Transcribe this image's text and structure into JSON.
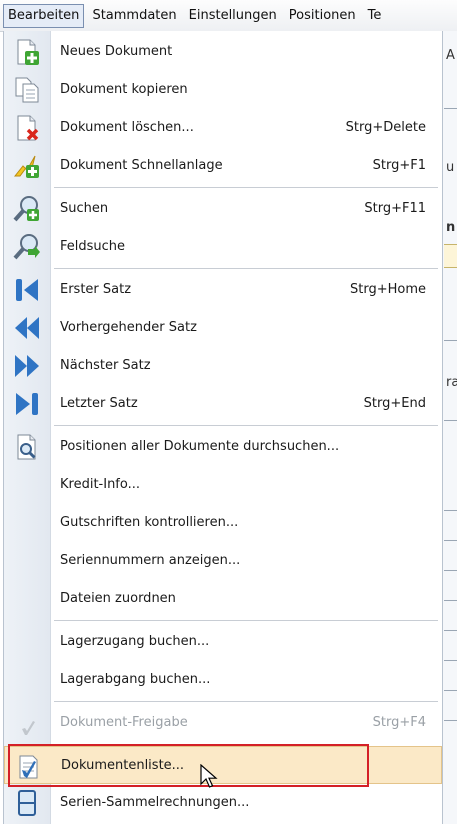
{
  "menubar": {
    "items": [
      {
        "label": "Bearbeiten"
      },
      {
        "label": "Stammdaten"
      },
      {
        "label": "Einstellungen"
      },
      {
        "label": "Positionen"
      },
      {
        "label": "Te"
      }
    ]
  },
  "menu": {
    "items": [
      {
        "label": "Neues Dokument",
        "shortcut": "",
        "icon": "new-document-icon"
      },
      {
        "label": "Dokument kopieren",
        "shortcut": "",
        "icon": "copy-document-icon"
      },
      {
        "label": "Dokument löschen...",
        "shortcut": "Strg+Delete",
        "icon": "delete-document-icon"
      },
      {
        "label": "Dokument Schnellanlage",
        "shortcut": "Strg+F1",
        "icon": "quick-create-icon"
      },
      {
        "label": "Suchen",
        "shortcut": "Strg+F11",
        "icon": "search-icon"
      },
      {
        "label": "Feldsuche",
        "shortcut": "",
        "icon": "field-search-icon"
      },
      {
        "label": "Erster Satz",
        "shortcut": "Strg+Home",
        "icon": "first-record-icon"
      },
      {
        "label": "Vorhergehender Satz",
        "shortcut": "",
        "icon": "previous-record-icon"
      },
      {
        "label": "Nächster Satz",
        "shortcut": "",
        "icon": "next-record-icon"
      },
      {
        "label": "Letzter Satz",
        "shortcut": "Strg+End",
        "icon": "last-record-icon"
      },
      {
        "label": "Positionen aller Dokumente durchsuchen...",
        "shortcut": "",
        "icon": "search-positions-icon"
      },
      {
        "label": "Kredit-Info...",
        "shortcut": "",
        "icon": ""
      },
      {
        "label": "Gutschriften kontrollieren...",
        "shortcut": "",
        "icon": ""
      },
      {
        "label": "Seriennummern anzeigen...",
        "shortcut": "",
        "icon": ""
      },
      {
        "label": "Dateien zuordnen",
        "shortcut": "",
        "icon": ""
      },
      {
        "label": "Lagerzugang buchen...",
        "shortcut": "",
        "icon": ""
      },
      {
        "label": "Lagerabgang buchen...",
        "shortcut": "",
        "icon": ""
      },
      {
        "label": "Dokument-Freigabe",
        "shortcut": "Strg+F4",
        "icon": "approval-icon",
        "disabled": true
      },
      {
        "label": "Dokumentenliste...",
        "shortcut": "",
        "icon": "document-list-icon",
        "hover": true
      },
      {
        "label": "Serien-Sammelrechnungen...",
        "shortcut": "",
        "icon": "collective-invoice-icon"
      }
    ]
  },
  "background": {
    "fragments": [
      "A",
      "u",
      "n",
      "ra"
    ]
  },
  "colors": {
    "highlight_border": "#d42027",
    "hover_background": "#fbe9c7",
    "gutter": "#e8edf3"
  }
}
